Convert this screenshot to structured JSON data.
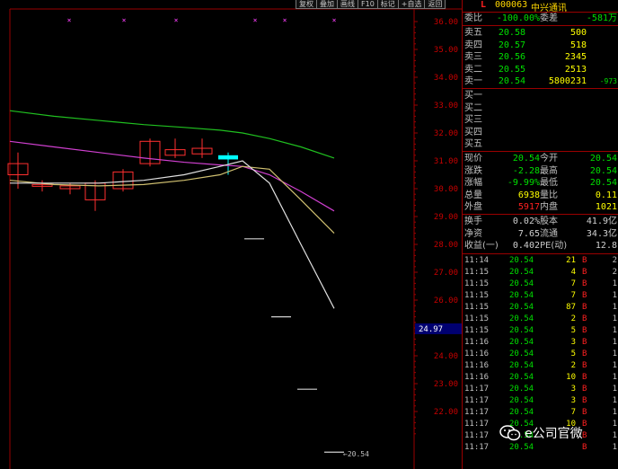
{
  "toolbar": {
    "buttons": [
      "复权",
      "叠加",
      "画线",
      "F10",
      "标记",
      "+自选",
      "返回"
    ]
  },
  "chart": {
    "price_labels": [
      "36.00",
      "35.00",
      "34.00",
      "33.00",
      "32.00",
      "31.00",
      "30.00",
      "29.00",
      "28.00",
      "27.00",
      "26.00",
      "25.00",
      "24.00",
      "23.00",
      "22.00"
    ],
    "current_price_tag": "24.97",
    "bottom_label": "←20.54"
  },
  "quote_header": {
    "market": "L",
    "code": "000063",
    "name": "中兴通讯"
  },
  "order_ratio": {
    "label1": "委比",
    "value1": "-100.00%",
    "label2": "委差",
    "value2": "-581万"
  },
  "asks": [
    {
      "label": "卖五",
      "price": "20.58",
      "volume": "500",
      "change": ""
    },
    {
      "label": "卖四",
      "price": "20.57",
      "volume": "518",
      "change": ""
    },
    {
      "label": "卖三",
      "price": "20.56",
      "volume": "2345",
      "change": ""
    },
    {
      "label": "卖二",
      "price": "20.55",
      "volume": "2513",
      "change": ""
    },
    {
      "label": "卖一",
      "price": "20.54",
      "volume": "5800231",
      "change": "-973"
    }
  ],
  "bids": [
    {
      "label": "买一"
    },
    {
      "label": "买二"
    },
    {
      "label": "买三"
    },
    {
      "label": "买四"
    },
    {
      "label": "买五"
    }
  ],
  "stats": [
    {
      "l1": "现价",
      "v1": "20.54",
      "l2": "今开",
      "v2": "20.54"
    },
    {
      "l1": "涨跌",
      "v1": "-2.28",
      "l2": "最高",
      "v2": "20.54"
    },
    {
      "l1": "涨幅",
      "v1": "-9.99%",
      "l2": "最低",
      "v2": "20.54"
    },
    {
      "l1": "总量",
      "v1": "6938",
      "l2": "量比",
      "v2": "0.11"
    },
    {
      "l1": "外盘",
      "v1": "5917",
      "l2": "内盘",
      "v2": "1021"
    }
  ],
  "stats2": [
    {
      "l1": "换手",
      "v1": "0.02%",
      "l2": "股本",
      "v2": "41.9亿"
    },
    {
      "l1": "净资",
      "v1": "7.65",
      "l2": "流通",
      "v2": "34.3亿"
    },
    {
      "l1": "收益(一)",
      "v1": "0.402",
      "l2": "PE(动)",
      "v2": "12.8"
    }
  ],
  "ticks": [
    {
      "time": "11:14",
      "price": "20.54",
      "vol": "21",
      "flag": "B",
      "n": "2"
    },
    {
      "time": "11:15",
      "price": "20.54",
      "vol": "4",
      "flag": "B",
      "n": "2"
    },
    {
      "time": "11:15",
      "price": "20.54",
      "vol": "7",
      "flag": "B",
      "n": "1"
    },
    {
      "time": "11:15",
      "price": "20.54",
      "vol": "7",
      "flag": "B",
      "n": "1"
    },
    {
      "time": "11:15",
      "price": "20.54",
      "vol": "87",
      "flag": "B",
      "n": "1"
    },
    {
      "time": "11:15",
      "price": "20.54",
      "vol": "2",
      "flag": "B",
      "n": "1"
    },
    {
      "time": "11:15",
      "price": "20.54",
      "vol": "5",
      "flag": "B",
      "n": "1"
    },
    {
      "time": "11:16",
      "price": "20.54",
      "vol": "3",
      "flag": "B",
      "n": "1"
    },
    {
      "time": "11:16",
      "price": "20.54",
      "vol": "5",
      "flag": "B",
      "n": "1"
    },
    {
      "time": "11:16",
      "price": "20.54",
      "vol": "2",
      "flag": "B",
      "n": "1"
    },
    {
      "time": "11:16",
      "price": "20.54",
      "vol": "10",
      "flag": "B",
      "n": "1"
    },
    {
      "time": "11:17",
      "price": "20.54",
      "vol": "3",
      "flag": "B",
      "n": "1"
    },
    {
      "time": "11:17",
      "price": "20.54",
      "vol": "3",
      "flag": "B",
      "n": "1"
    },
    {
      "time": "11:17",
      "price": "20.54",
      "vol": "7",
      "flag": "B",
      "n": "1"
    },
    {
      "time": "11:17",
      "price": "20.54",
      "vol": "10",
      "flag": "B",
      "n": "1"
    },
    {
      "time": "11:17",
      "price": "20.54",
      "vol": "",
      "flag": "B",
      "n": "1"
    },
    {
      "time": "11:17",
      "price": "20.54",
      "vol": "",
      "flag": "B",
      "n": "1"
    }
  ],
  "watermark": {
    "text": "e公司官微"
  },
  "chart_data": {
    "type": "candlestick",
    "ylim": [
      21.5,
      36.2
    ],
    "candles": [
      {
        "o": 30.5,
        "c": 30.9,
        "h": 31.3,
        "l": 30.0
      },
      {
        "o": 30.1,
        "c": 30.15,
        "h": 30.3,
        "l": 29.9
      },
      {
        "o": 30.0,
        "c": 30.1,
        "h": 30.2,
        "l": 29.8
      },
      {
        "o": 29.6,
        "c": 30.2,
        "h": 30.3,
        "l": 29.2
      },
      {
        "o": 30.0,
        "c": 30.6,
        "h": 30.7,
        "l": 29.9
      },
      {
        "o": 30.9,
        "c": 31.7,
        "h": 31.8,
        "l": 30.8
      },
      {
        "o": 31.2,
        "c": 31.4,
        "h": 31.8,
        "l": 31.1
      },
      {
        "o": 31.25,
        "c": 31.45,
        "h": 31.8,
        "l": 31.1
      },
      {
        "o": 31.2,
        "c": 31.05,
        "h": 31.3,
        "l": 30.5
      },
      {
        "o": 28.2,
        "c": 28.2,
        "h": 28.2,
        "l": 28.2
      },
      {
        "o": 25.4,
        "c": 25.4,
        "h": 25.4,
        "l": 25.4
      },
      {
        "o": 22.8,
        "c": 22.8,
        "h": 22.8,
        "l": 22.8
      },
      {
        "o": 20.54,
        "c": 20.54,
        "h": 20.54,
        "l": 20.54
      }
    ],
    "ma_green": [
      32.8,
      32.6,
      32.45,
      32.3,
      32.2,
      32.1,
      32.0,
      31.8,
      31.5,
      31.1
    ],
    "ma_magenta": [
      31.7,
      31.5,
      31.3,
      31.1,
      30.95,
      30.85,
      30.8,
      30.5,
      29.9,
      29.2
    ],
    "ma_khaki": [
      30.3,
      30.15,
      30.1,
      30.15,
      30.3,
      30.5,
      30.8,
      30.7,
      29.6,
      28.4
    ],
    "ma_white": [
      30.2,
      30.2,
      30.2,
      30.3,
      30.5,
      30.8,
      31.0,
      30.2,
      28.0,
      25.7
    ]
  }
}
